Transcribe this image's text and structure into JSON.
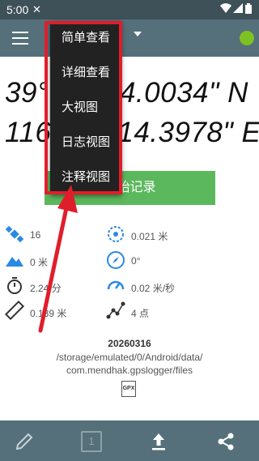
{
  "status_bar": {
    "time": "5:00"
  },
  "app_bar": {
    "status_color": "#7cc221",
    "accent": "#55707a"
  },
  "coordinates": {
    "latitude": "39° 54' 14.0034\" N",
    "longitude": "116° 23' 14.3978\" E"
  },
  "view_menu": {
    "items": [
      {
        "label": "简单查看"
      },
      {
        "label": "详细查看"
      },
      {
        "label": "大视图"
      },
      {
        "label": "日志视图"
      },
      {
        "label": "注释视图"
      }
    ]
  },
  "log_button": {
    "label": "开始记录"
  },
  "stats": {
    "satellites": "16",
    "accuracy": "0.021 米",
    "altitude": "0 米",
    "bearing": "0°",
    "duration": "2.24 分",
    "speed": "0.02 米/秒",
    "distance": "0.139 米",
    "points": "4 点"
  },
  "file": {
    "date": "20260316",
    "path_line1": "/storage/emulated/0/Android/data/",
    "path_line2": "com.mendhak.gpslogger/files",
    "type_label": "GPX"
  },
  "bottom_bar": {
    "page_number": "1"
  },
  "colors": {
    "highlight": "#e01e2b",
    "log_button": "#5cb85c",
    "icon_blue": "#2a8ae3"
  }
}
